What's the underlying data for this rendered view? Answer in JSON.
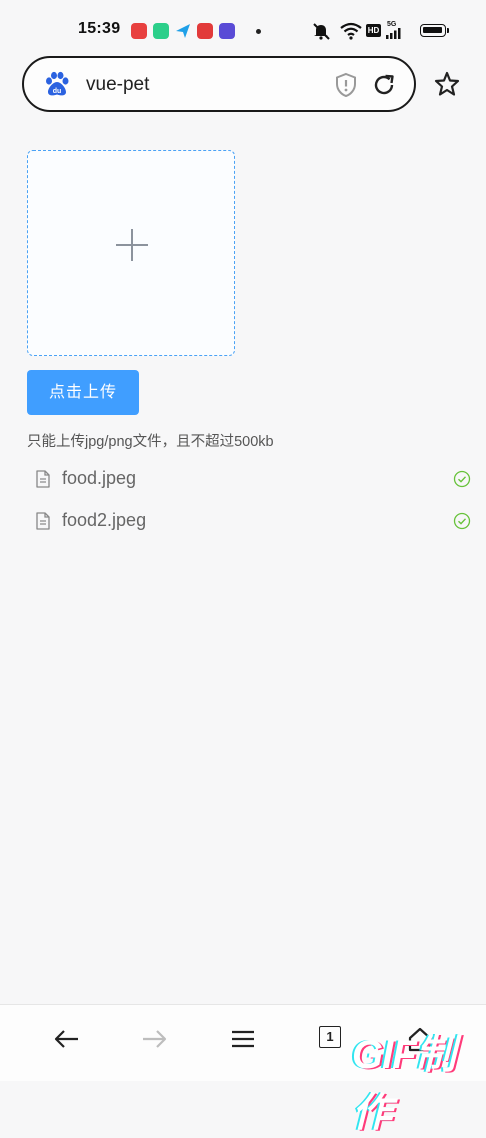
{
  "status_bar": {
    "time": "15:39",
    "notifications": [
      {
        "icon": "app-notif-red-icon",
        "color": "#e8403f"
      },
      {
        "icon": "app-notif-green-icon",
        "color": "#2ccf8a"
      },
      {
        "icon": "app-notif-send-icon",
        "color": "#1fa0e8"
      },
      {
        "icon": "app-notif-news-icon",
        "color": "#e23a3a"
      },
      {
        "icon": "app-notif-purple-icon",
        "color": "#5a4bd6"
      }
    ],
    "indicators": [
      "mute-icon",
      "wifi-icon",
      "hd-icon",
      "signal-5g-icon",
      "battery-icon"
    ],
    "hd_label": "HD",
    "network_label": "5G"
  },
  "browser": {
    "address": "vue-pet",
    "site_icon": "baidu-paw-icon",
    "tab_count": "1"
  },
  "upload": {
    "button_label": "点击上传",
    "tip": "只能上传jpg/png文件，且不超过500kb",
    "files": [
      {
        "name": "food.jpeg",
        "status": "success"
      },
      {
        "name": "food2.jpeg",
        "status": "success"
      }
    ]
  },
  "colors": {
    "accent": "#409eff",
    "success": "#67c23a",
    "background": "#f7f7f8"
  },
  "watermark": "GIF制作"
}
